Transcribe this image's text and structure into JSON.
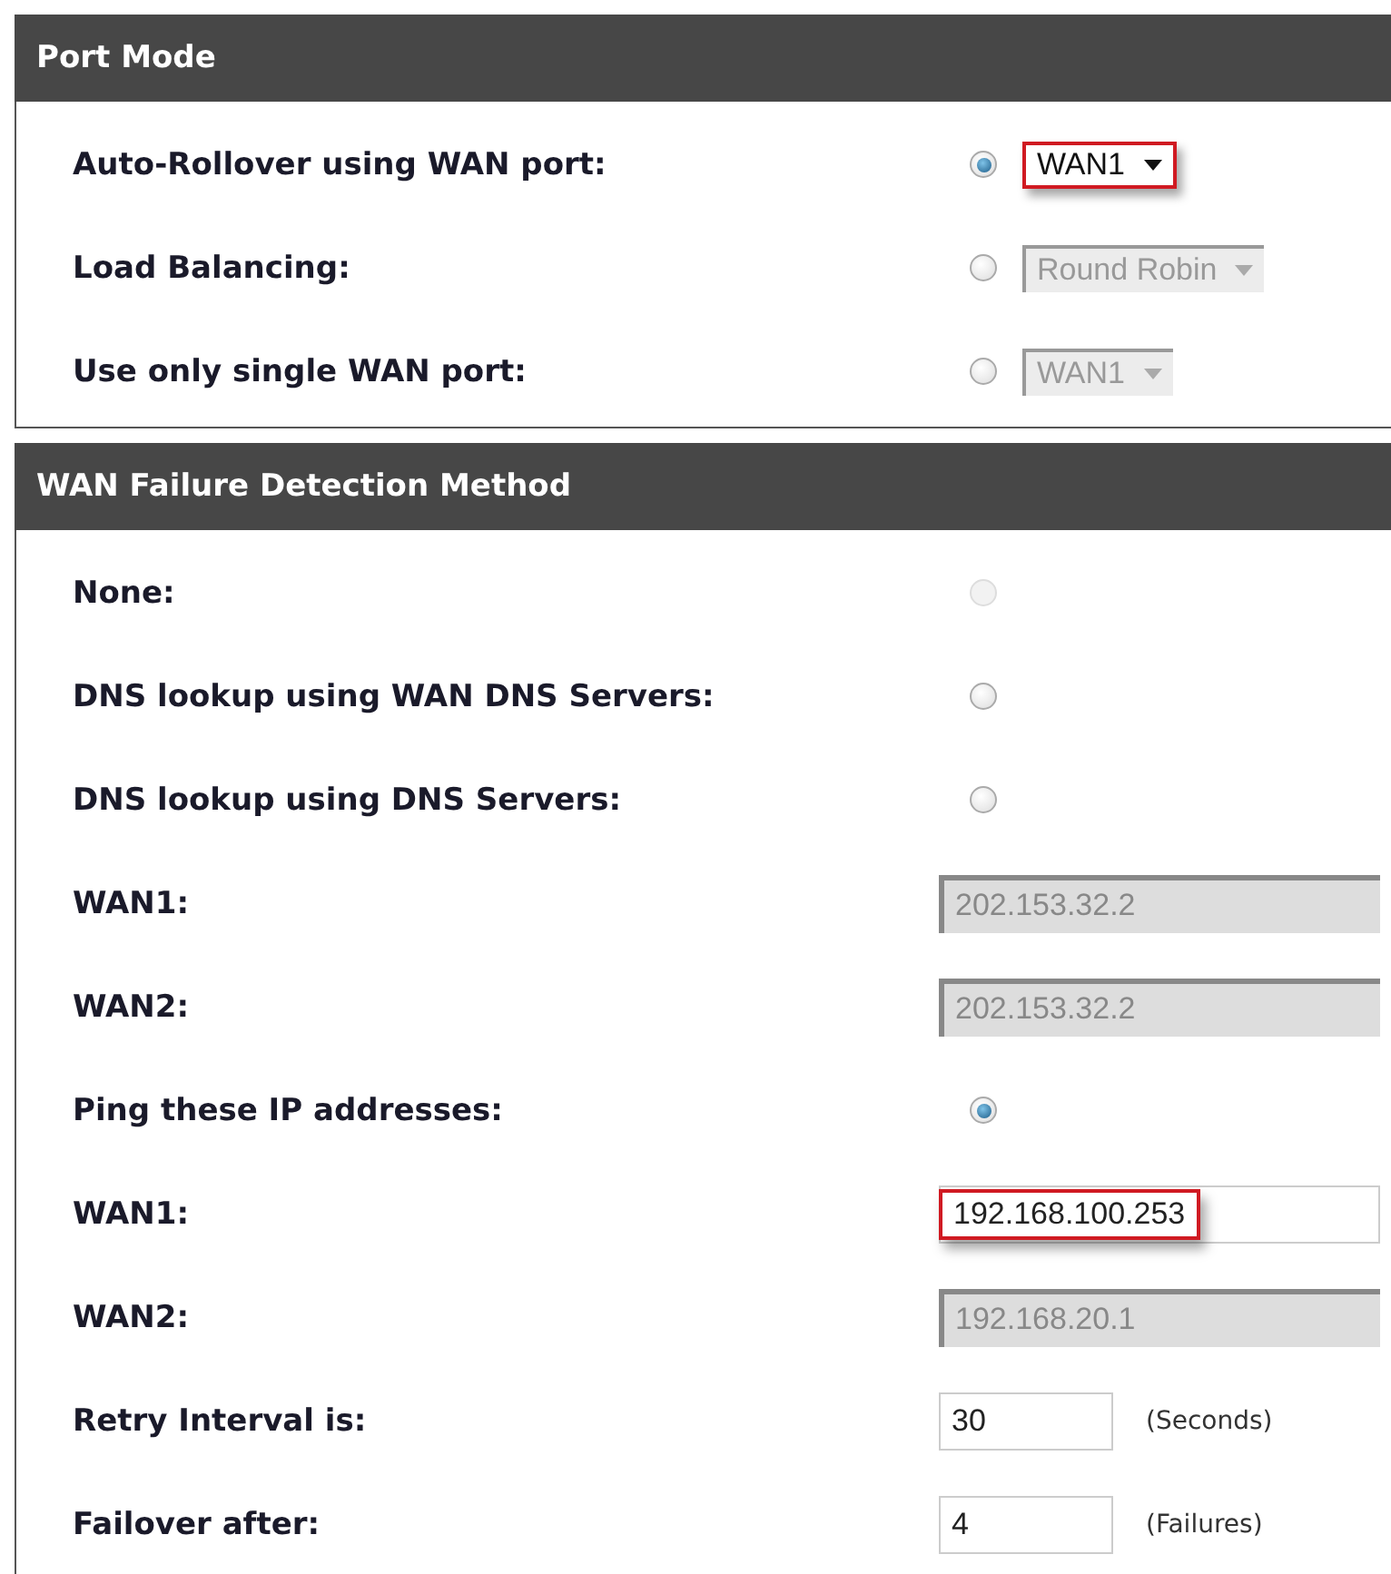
{
  "sections": [
    {
      "title": "Port Mode",
      "rows": [
        {
          "kind": "radio_select",
          "label": "Auto-Rollover using WAN port:",
          "radio": {
            "selected": true,
            "disabled": false
          },
          "select": {
            "value": "WAN1",
            "disabled": false,
            "highlighted": true
          }
        },
        {
          "kind": "radio_select",
          "label": "Load Balancing:",
          "radio": {
            "selected": false,
            "disabled": false
          },
          "select": {
            "value": "Round Robin",
            "disabled": true,
            "highlighted": false
          }
        },
        {
          "kind": "radio_select",
          "label": "Use only single WAN port:",
          "radio": {
            "selected": false,
            "disabled": false
          },
          "select": {
            "value": "WAN1",
            "disabled": true,
            "highlighted": false
          }
        }
      ]
    },
    {
      "title": "WAN Failure Detection Method",
      "rows": [
        {
          "kind": "radio",
          "label": "None:",
          "radio": {
            "selected": false,
            "disabled": true
          }
        },
        {
          "kind": "radio",
          "label": "DNS lookup using WAN DNS Servers:",
          "radio": {
            "selected": false,
            "disabled": false
          }
        },
        {
          "kind": "radio",
          "label": "DNS lookup using DNS Servers:",
          "radio": {
            "selected": false,
            "disabled": false
          }
        },
        {
          "kind": "text",
          "label": "WAN1:",
          "input": {
            "value": "202.153.32.2",
            "disabled": true,
            "highlighted": false
          }
        },
        {
          "kind": "text",
          "label": "WAN2:",
          "input": {
            "value": "202.153.32.2",
            "disabled": true,
            "highlighted": false
          }
        },
        {
          "kind": "radio",
          "label": "Ping these IP addresses:",
          "radio": {
            "selected": true,
            "disabled": false
          }
        },
        {
          "kind": "text",
          "label": "WAN1:",
          "input": {
            "value": "192.168.100.253",
            "disabled": false,
            "highlighted": true
          }
        },
        {
          "kind": "text",
          "label": "WAN2:",
          "input": {
            "value": "192.168.20.1",
            "disabled": true,
            "highlighted": false
          }
        },
        {
          "kind": "text_unit",
          "label": "Retry Interval is:",
          "input": {
            "value": "30",
            "disabled": false,
            "highlighted": false
          },
          "unit": "(Seconds)"
        },
        {
          "kind": "text_unit",
          "label": "Failover after:",
          "input": {
            "value": "4",
            "disabled": false,
            "highlighted": false
          },
          "unit": "(Failures)"
        }
      ]
    }
  ]
}
